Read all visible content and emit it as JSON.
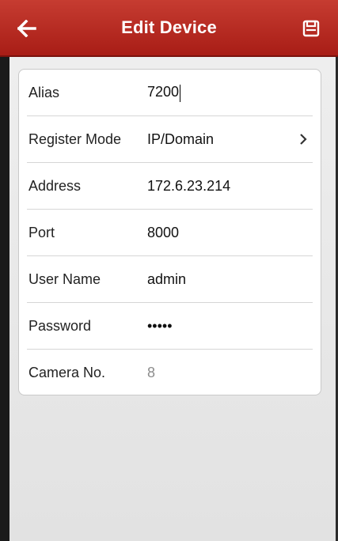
{
  "header": {
    "title": "Edit Device",
    "back_icon": "arrow-left-icon",
    "save_icon": "floppy-save-icon",
    "background": "#b3261e"
  },
  "form": {
    "fields": [
      {
        "label": "Alias",
        "value": "7200",
        "editing": true
      },
      {
        "label": "Register Mode",
        "value": "IP/Domain",
        "has_chevron": true
      },
      {
        "label": "Address",
        "value": "172.6.23.214"
      },
      {
        "label": "Port",
        "value": "8000"
      },
      {
        "label": "User Name",
        "value": "admin"
      },
      {
        "label": "Password",
        "value": "•••••"
      },
      {
        "label": "Camera No.",
        "value": "8",
        "read_only": true
      }
    ]
  }
}
